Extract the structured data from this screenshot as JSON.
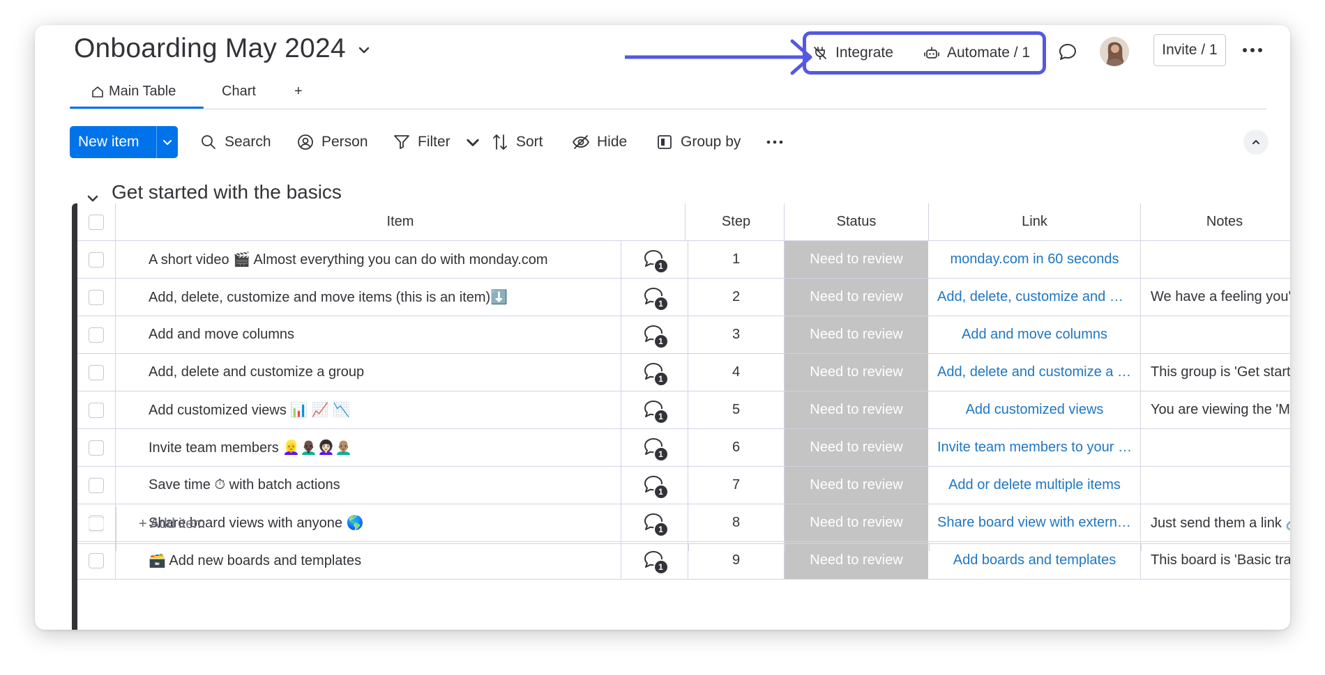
{
  "board": {
    "title": "Onboarding May 2024",
    "integrate_label": "Integrate",
    "automate_label": "Automate / 1",
    "invite_label": "Invite / 1"
  },
  "tabs": [
    {
      "label": "Main Table",
      "active": true
    },
    {
      "label": "Chart",
      "active": false
    },
    {
      "label": "+",
      "active": false
    }
  ],
  "toolbar": {
    "new_item": "New item",
    "search": "Search",
    "person": "Person",
    "filter": "Filter",
    "sort": "Sort",
    "hide": "Hide",
    "group_by": "Group by"
  },
  "group": {
    "title": "Get started with the basics",
    "color": "#323338",
    "add_item": "+ Add item"
  },
  "columns": {
    "item": "Item",
    "step": "Step",
    "status": "Status",
    "link": "Link",
    "notes": "Notes"
  },
  "rows": [
    {
      "item": "A short video 🎬 Almost everything you can do with monday.com",
      "conv_count": "1",
      "step": "1",
      "status": "Need to review",
      "link": "monday.com in 60 seconds",
      "notes": ""
    },
    {
      "item": "Add, delete, customize and move items (this is an item)⬇️",
      "conv_count": "1",
      "step": "2",
      "status": "Need to review",
      "link": "Add, delete, customize and mo...",
      "notes": "We have a feeling you'll u"
    },
    {
      "item": "Add and move columns",
      "conv_count": "1",
      "step": "3",
      "status": "Need to review",
      "link": "Add and move columns",
      "notes": ""
    },
    {
      "item": "Add, delete and customize a group",
      "conv_count": "1",
      "step": "4",
      "status": "Need to review",
      "link": "Add, delete and customize a gr...",
      "notes": "This group is 'Get started"
    },
    {
      "item": "Add customized views 📊 📈 📉",
      "conv_count": "1",
      "step": "5",
      "status": "Need to review",
      "link": "Add customized views",
      "notes": "You are viewing the 'Main"
    },
    {
      "item": "Invite team members 👱‍♀️👨🏿‍🦲👩🏻‍🦱👨🏽‍🦲",
      "conv_count": "1",
      "step": "6",
      "status": "Need to review",
      "link": "Invite team members to your ac...",
      "notes": ""
    },
    {
      "item": "Save time ⏱ with batch actions",
      "conv_count": "1",
      "step": "7",
      "status": "Need to review",
      "link": "Add or delete multiple items",
      "notes": ""
    },
    {
      "item": "Share board views with anyone 🌎",
      "conv_count": "1",
      "step": "8",
      "status": "Need to review",
      "link": "Share board view with external ...",
      "notes": "Just send them a link 🔗"
    },
    {
      "item": "🗃️ Add new boards and templates",
      "conv_count": "1",
      "step": "9",
      "status": "Need to review",
      "link": "Add boards and templates",
      "notes": "This board is 'Basic trainin"
    }
  ],
  "colors": {
    "primary": "#0073ea",
    "highlight": "#5559df",
    "status_grey": "#c4c4c4",
    "link": "#1f76c2"
  },
  "icons": {
    "integrate": "plug-icon",
    "automate": "robot-icon",
    "updates": "chat-bubble-icon",
    "more": "more-dots-icon",
    "home": "home-icon",
    "search": "search-icon",
    "person": "person-icon",
    "filter": "filter-icon",
    "sort": "sort-icon",
    "hide": "eye-off-icon",
    "group_by": "group-by-icon",
    "conversation": "conversation-icon"
  }
}
